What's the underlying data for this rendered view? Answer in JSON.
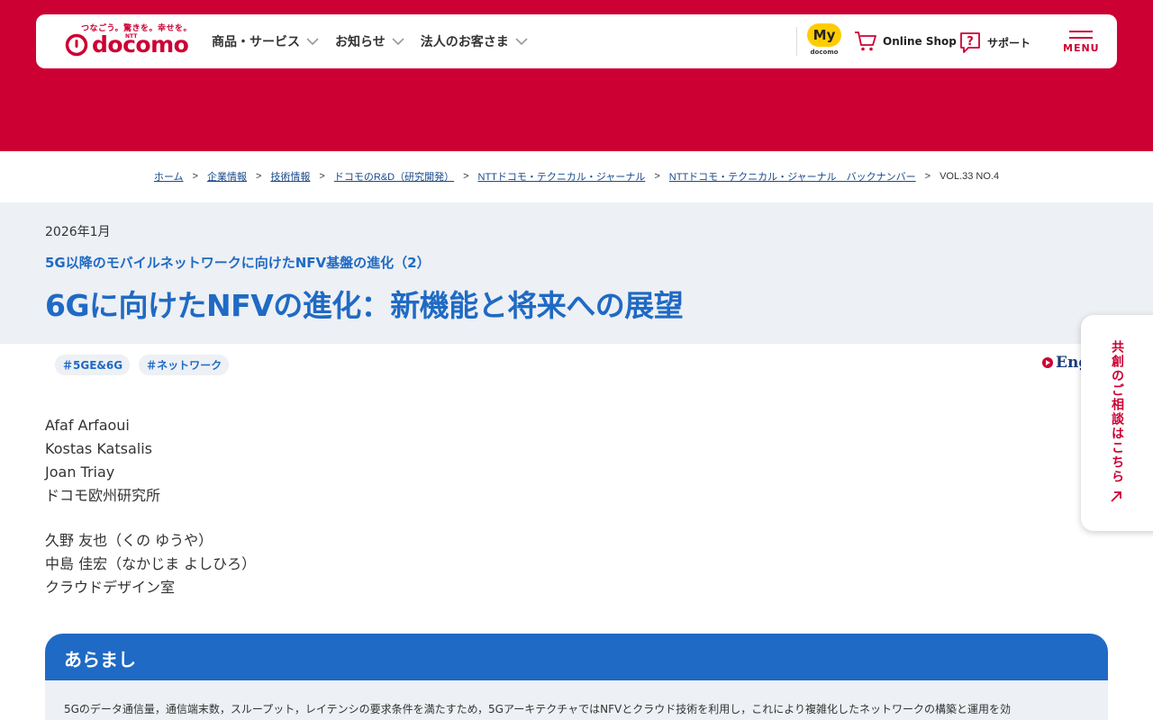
{
  "header": {
    "tagline": "つなごう。驚きを。幸せを。",
    "logo_ntt": "NTT",
    "logo_text": "docomo",
    "nav": [
      {
        "label": "商品・サービス"
      },
      {
        "label": "お知らせ"
      },
      {
        "label": "法人のお客さま"
      }
    ],
    "my_docomo": {
      "badge": "My",
      "sub": "docomo"
    },
    "online_shop": "Online Shop",
    "support": "サポート",
    "menu": "MENU"
  },
  "breadcrumb": {
    "items": [
      "ホーム",
      "企業情報",
      "技術情報",
      "ドコモのR&D（研究開発）",
      "NTTドコモ・テクニカル・ジャーナル",
      "NTTドコモ・テクニカル・ジャーナル　バックナンバー"
    ],
    "separator": ">",
    "current": "VOL.33 NO.4"
  },
  "article": {
    "date": "2026年1月",
    "series": "5G以降のモバイルネットワークに向けたNFV基盤の進化（2）",
    "title": "6Gに向けたNFVの進化：新機能と将来への展望",
    "tags": [
      "＃5GE&6G",
      "＃ネットワーク"
    ],
    "english_link": "Eng"
  },
  "authors": {
    "group1": [
      "Afaf Arfaoui",
      "Kostas Katsalis",
      "Joan Triay",
      "ドコモ欧州研究所"
    ],
    "group2": [
      "久野 友也（くの ゆうや）",
      "中島 佳宏（なかじま よしひろ）",
      "クラウドデザイン室"
    ]
  },
  "consult": {
    "label": "共創のご相談はこちら"
  },
  "summary": {
    "heading": "あらまし",
    "text": "5Gのデータ通信量，通信端末数，スループット，レイテンシの要求条件を満たすため，5GアーキテクチャではNFVとクラウド技術を利用し，これにより複雑化したネットワークの構築と運用を効"
  },
  "colors": {
    "brand_red": "#cc0033",
    "link_blue": "#1f6ac4",
    "band_gray": "#edf0f4",
    "my_yellow": "#ffcc00"
  }
}
